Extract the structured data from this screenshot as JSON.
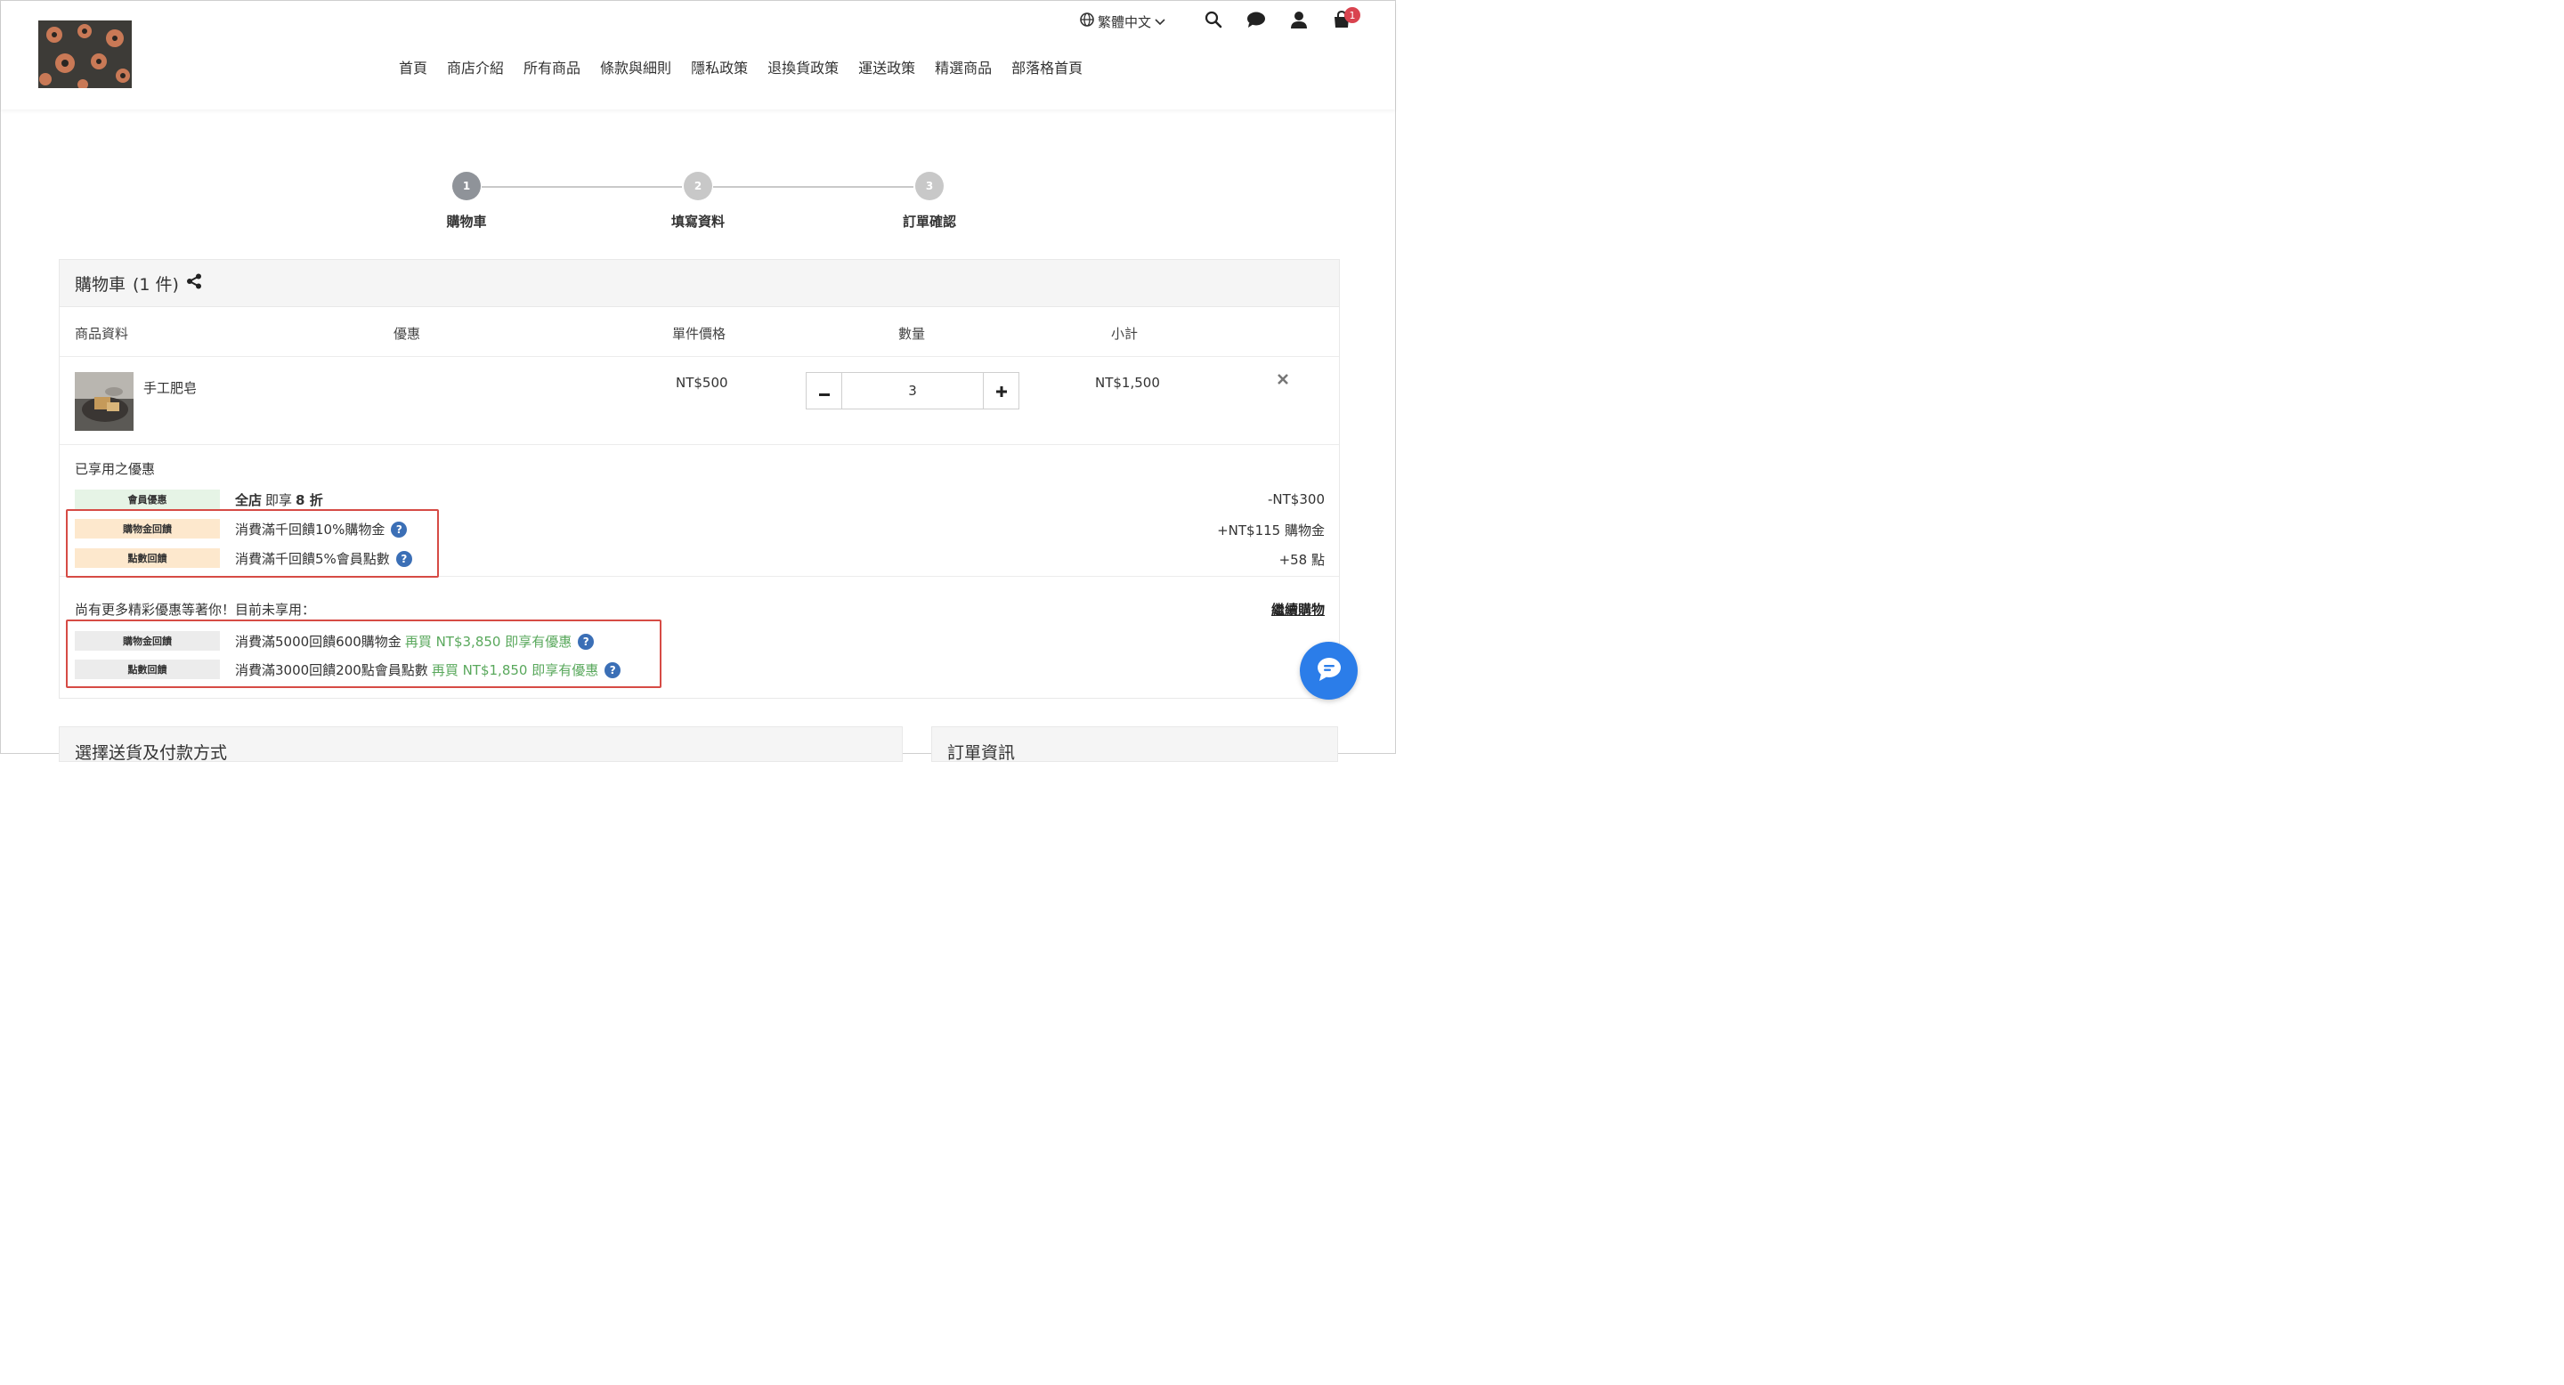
{
  "header": {
    "language": "繁體中文",
    "cart_count": "1",
    "nav": [
      "首頁",
      "商店介紹",
      "所有商品",
      "條款與細則",
      "隱私政策",
      "退換貨政策",
      "運送政策",
      "精選商品",
      "部落格首頁"
    ]
  },
  "steps": [
    {
      "num": "1",
      "label": "購物車"
    },
    {
      "num": "2",
      "label": "填寫資料"
    },
    {
      "num": "3",
      "label": "訂單確認"
    }
  ],
  "cart": {
    "title": "購物車",
    "count": "(1 件)",
    "columns": {
      "product": "商品資料",
      "discount": "優惠",
      "unit_price": "單件價格",
      "qty": "數量",
      "subtotal": "小計"
    },
    "item": {
      "name": "手工肥皂",
      "price": "NT$500",
      "qty": "3",
      "subtotal": "NT$1,500",
      "qty_minus": "−",
      "qty_plus": "+"
    },
    "applied_title": "已享用之優惠",
    "applied": [
      {
        "tag": "會員優惠",
        "text_bold": "全店",
        "text_mid": " 即享 ",
        "text_tail": "8 折",
        "value": "-NT$300",
        "tag_color": "#e6f4e6"
      },
      {
        "tag": "購物金回饋",
        "text": "消費滿千回饋10%購物金",
        "value": "+NT$115 購物金",
        "tag_color": "#fde8cd"
      },
      {
        "tag": "點數回饋",
        "text": "消費滿千回饋5%會員點數",
        "value": "+58 點",
        "tag_color": "#fde8cd"
      }
    ],
    "more_title": "尚有更多精彩優惠等著你！目前未享用：",
    "continue_link": "繼續購物",
    "more": [
      {
        "tag": "購物金回饋",
        "text": "消費滿5000回饋600購物金",
        "hint": "再買 NT$3,850 即享有優惠",
        "tag_color": "#ececec"
      },
      {
        "tag": "點數回饋",
        "text": "消費滿3000回饋200點會員點數",
        "hint": "再買 NT$1,850 即享有優惠",
        "tag_color": "#ececec"
      }
    ]
  },
  "bottom": {
    "shipping_title": "選擇送貨及付款方式",
    "order_title": "訂單資訊"
  },
  "icons": {
    "help": "?"
  }
}
